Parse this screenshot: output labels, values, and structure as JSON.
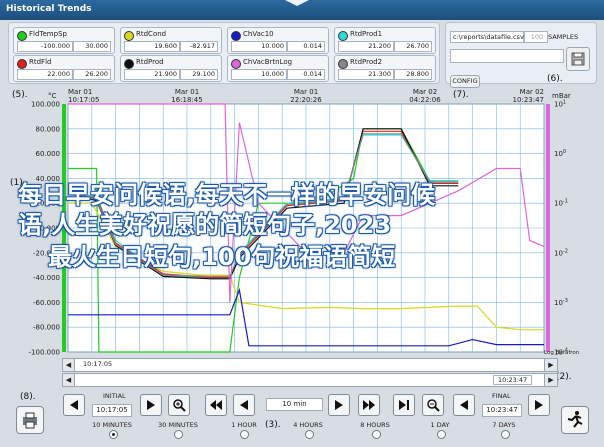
{
  "window": {
    "title": "Historical Trends"
  },
  "legend": [
    {
      "name": "FldTempSp",
      "color": "#22cc22",
      "low": "-100.000",
      "high": "30.000"
    },
    {
      "name": "RtdCond",
      "color": "#d8d820",
      "low": "19.600",
      "high": "-82.917"
    },
    {
      "name": "ChVac10",
      "color": "#1818c8",
      "low": "10.000",
      "high": "0.014"
    },
    {
      "name": "RtdProd1",
      "color": "#30d8d8",
      "low": "21.200",
      "high": "26.700"
    },
    {
      "name": "RtdFld",
      "color": "#dd2222",
      "low": "22.000",
      "high": "26.200"
    },
    {
      "name": "RtdProd",
      "color": "#111111",
      "low": "21.900",
      "high": "29.100"
    },
    {
      "name": "ChVacBrtnLog",
      "color": "#dd66dd",
      "low": "10.000",
      "high": "0.014"
    },
    {
      "name": "RtdProd2",
      "color": "#888888",
      "low": "21.300",
      "high": "28.800"
    }
  ],
  "file": {
    "path": "c:\\reports\\datafile.csv",
    "samples_value": "100",
    "samples_label": "SAMPLES",
    "config_label": "CONFIG"
  },
  "callouts": {
    "c1": "(1).",
    "c2": "(2).",
    "c3": "(3).",
    "c5": "(5).",
    "c6": "(6).",
    "c7": "(7).",
    "c8": "(8)."
  },
  "chart_data": {
    "type": "line",
    "left_unit": "°C",
    "right_unit": "mBar",
    "left_ticks": [
      "100.000",
      "80.000",
      "60.000",
      "40.000",
      "20.000",
      "0.000",
      "-20.000",
      "-40.000",
      "-60.000",
      "-80.000",
      "-100.000"
    ],
    "right_ticks": [
      "10^1",
      "10^0",
      "10^-1",
      "10^-2",
      "10^-3",
      "10^-4"
    ],
    "time_ticks": [
      {
        "date": "Mar 01",
        "time": "10:17:05"
      },
      {
        "date": "Mar 01",
        "time": "16:18:45"
      },
      {
        "date": "Mar 01",
        "time": "22:20:26"
      },
      {
        "date": "Mar 02",
        "time": "04:22:06"
      },
      {
        "date": "Mar 02",
        "time": "10:23:47"
      }
    ],
    "ylim_left": [
      -100,
      100
    ],
    "series": [
      {
        "name": "FldTempSp",
        "color": "#22cc22",
        "x": [
          0,
          0.06,
          0.065,
          0.08,
          0.15,
          0.28,
          0.34,
          0.36,
          0.4,
          0.52,
          0.6,
          0.62,
          0.66,
          0.7,
          0.76,
          0.82
        ],
        "y": [
          48,
          48,
          -100,
          -100,
          -100,
          -100,
          -100,
          -40,
          20,
          20,
          40,
          80,
          80,
          80,
          38,
          38
        ]
      },
      {
        "name": "RtdCond",
        "color": "#d8d820",
        "x": [
          0,
          0.05,
          0.1,
          0.2,
          0.28,
          0.34,
          0.36,
          0.45,
          0.55,
          0.62,
          0.7,
          0.76,
          0.82,
          0.86,
          0.9,
          0.95,
          1
        ],
        "y": [
          20,
          20,
          -15,
          -35,
          -38,
          -38,
          -60,
          -65,
          -64,
          -65,
          -65,
          -64,
          -63,
          -63,
          -80,
          -82,
          -82
        ]
      },
      {
        "name": "ChVac10",
        "color": "#1818c8",
        "x": [
          0,
          0.34,
          0.36,
          0.38,
          0.6,
          0.8,
          0.85,
          0.9,
          1
        ],
        "y": [
          -70,
          -70,
          -50,
          -95,
          -95,
          -95,
          -90,
          -94,
          -94
        ]
      },
      {
        "name": "RtdProd1",
        "color": "#30d8d8",
        "x": [
          0,
          0.06,
          0.1,
          0.2,
          0.3,
          0.34,
          0.36,
          0.46,
          0.58,
          0.62,
          0.7,
          0.76,
          0.82
        ],
        "y": [
          30,
          25,
          -10,
          -38,
          -40,
          -40,
          -20,
          20,
          24,
          75,
          75,
          38,
          38
        ]
      },
      {
        "name": "RtdFld",
        "color": "#dd2222",
        "x": [
          0,
          0.06,
          0.1,
          0.2,
          0.3,
          0.34,
          0.36,
          0.46,
          0.58,
          0.62,
          0.7,
          0.76,
          0.82
        ],
        "y": [
          28,
          24,
          -12,
          -37,
          -40,
          -40,
          -22,
          18,
          22,
          78,
          78,
          36,
          36
        ]
      },
      {
        "name": "RtdProd",
        "color": "#111111",
        "x": [
          0,
          0.06,
          0.1,
          0.2,
          0.3,
          0.34,
          0.36,
          0.46,
          0.58,
          0.62,
          0.7,
          0.76,
          0.82
        ],
        "y": [
          28,
          22,
          -14,
          -39,
          -41,
          -41,
          -24,
          16,
          20,
          80,
          80,
          34,
          34
        ]
      },
      {
        "name": "ChVacBrtnLog",
        "color": "#dd66dd",
        "x": [
          0,
          0.33,
          0.34,
          0.36,
          0.4,
          0.5,
          0.58,
          0.62,
          0.7,
          0.76,
          0.82,
          0.9,
          0.95,
          0.97,
          1
        ],
        "y": [
          100,
          100,
          -60,
          85,
          20,
          -20,
          -20,
          10,
          10,
          20,
          30,
          48,
          48,
          -10,
          -15
        ]
      },
      {
        "name": "RtdProd2",
        "color": "#888888",
        "x": [
          0,
          0.06,
          0.1,
          0.2,
          0.3,
          0.34,
          0.36,
          0.46,
          0.58,
          0.62,
          0.7,
          0.76,
          0.82
        ],
        "y": [
          29,
          23,
          -13,
          -38,
          -39,
          -39,
          -21,
          19,
          23,
          76,
          76,
          37,
          37
        ]
      }
    ]
  },
  "range": {
    "start": "10:17:05",
    "end": "10:23:47",
    "scale_label": "Log Barafron"
  },
  "nav": {
    "initial_label": "INITIAL",
    "initial_value": "10:17:05",
    "final_label": "FINAL",
    "final_value": "10:23:47",
    "step_value": "10 min",
    "radios": [
      "10 MINUTES",
      "30 MINUTES",
      "1 HOUR",
      "4 HOURS",
      "8 HOURS",
      "1 DAY",
      "7 DAYS"
    ],
    "selected": "10 MINUTES"
  },
  "overlay": {
    "line1": "每日早安问候语,每天不一样的早安问候",
    "line2": "语,人生美好祝愿的简短句子,2023",
    "line3": "最火生日短句,100句祝福语简短"
  }
}
